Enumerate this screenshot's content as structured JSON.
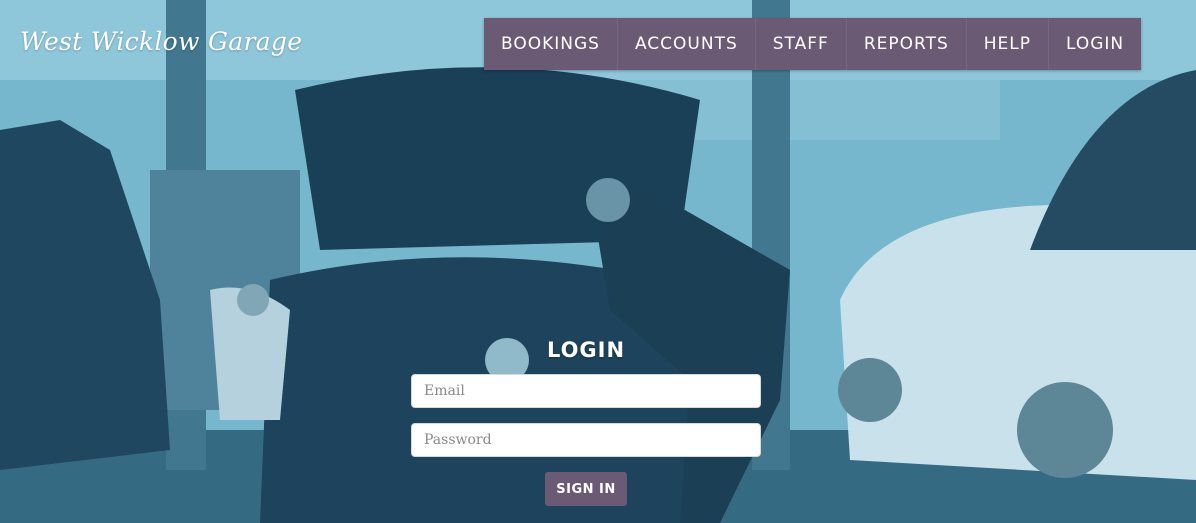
{
  "header": {
    "logo_text": "West Wicklow Garage"
  },
  "nav": {
    "items": [
      {
        "label": "BOOKINGS"
      },
      {
        "label": "ACCOUNTS"
      },
      {
        "label": "STAFF"
      },
      {
        "label": "REPORTS"
      },
      {
        "label": "HELP"
      },
      {
        "label": "LOGIN"
      }
    ]
  },
  "login": {
    "title": "LOGIN",
    "email_placeholder": "Email",
    "password_placeholder": "Password",
    "submit_label": "SIGN IN"
  },
  "colors": {
    "nav_background": "#6b5a73",
    "button_background": "#6b5a73",
    "overlay_tint": "#6fb0c8"
  }
}
